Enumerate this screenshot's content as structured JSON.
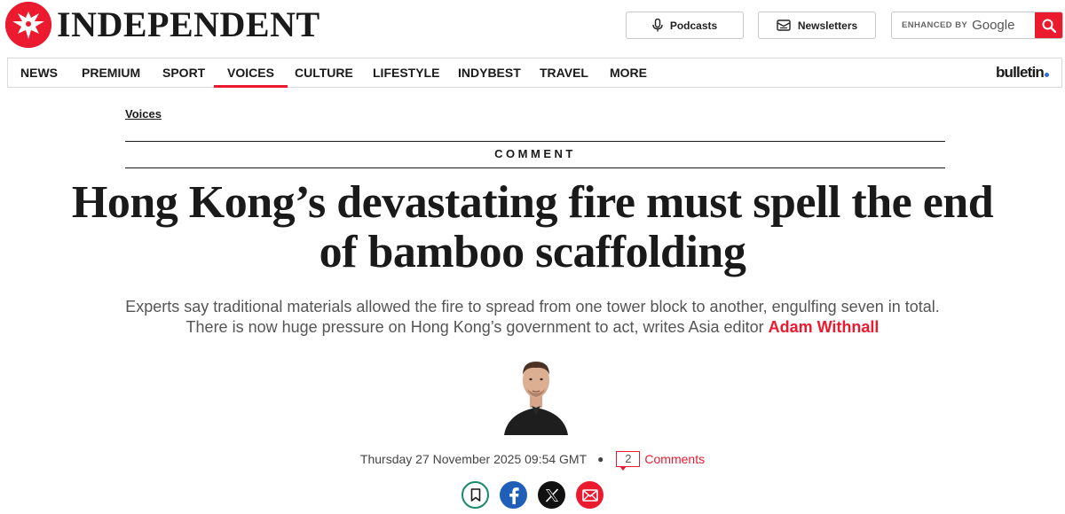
{
  "header": {
    "logo_text": "INDEPENDENT",
    "podcasts_label": "Podcasts",
    "newsletters_label": "Newsletters",
    "search": {
      "enhanced_label": "ENHANCED BY",
      "provider": "Google"
    }
  },
  "nav": {
    "items": [
      {
        "label": "News"
      },
      {
        "label": "Premium"
      },
      {
        "label": "Sport"
      },
      {
        "label": "Voices"
      },
      {
        "label": "Culture"
      },
      {
        "label": "Lifestyle"
      },
      {
        "label": "IndyBest"
      },
      {
        "label": "Travel"
      },
      {
        "label": "More"
      }
    ],
    "active": "Voices",
    "bulletin_label": "bulletin"
  },
  "article": {
    "breadcrumb": "Voices",
    "section_label": "COMMENT",
    "headline": "Hong Kong’s devastating fire must spell the end of bamboo scaffolding",
    "standfirst_line1": "Experts say traditional materials allowed the fire to spread from one tower block to another, engulfing seven in total.",
    "standfirst_line2": "There is now huge pressure on Hong Kong’s government to act, writes Asia editor",
    "author": "Adam Withnall",
    "date": "Thursday 27 November 2025 09:54 GMT",
    "comment_count": "2",
    "comments_label": "Comments"
  },
  "share": {
    "buttons": [
      "bookmark-icon",
      "facebook-icon",
      "x-icon",
      "email-icon"
    ]
  },
  "colors": {
    "accent": "#ec1a2e",
    "text": "#1a1a1a",
    "standfirst": "#555555",
    "facebook": "#1f5fb8",
    "bookmark": "#1a8a6a"
  }
}
